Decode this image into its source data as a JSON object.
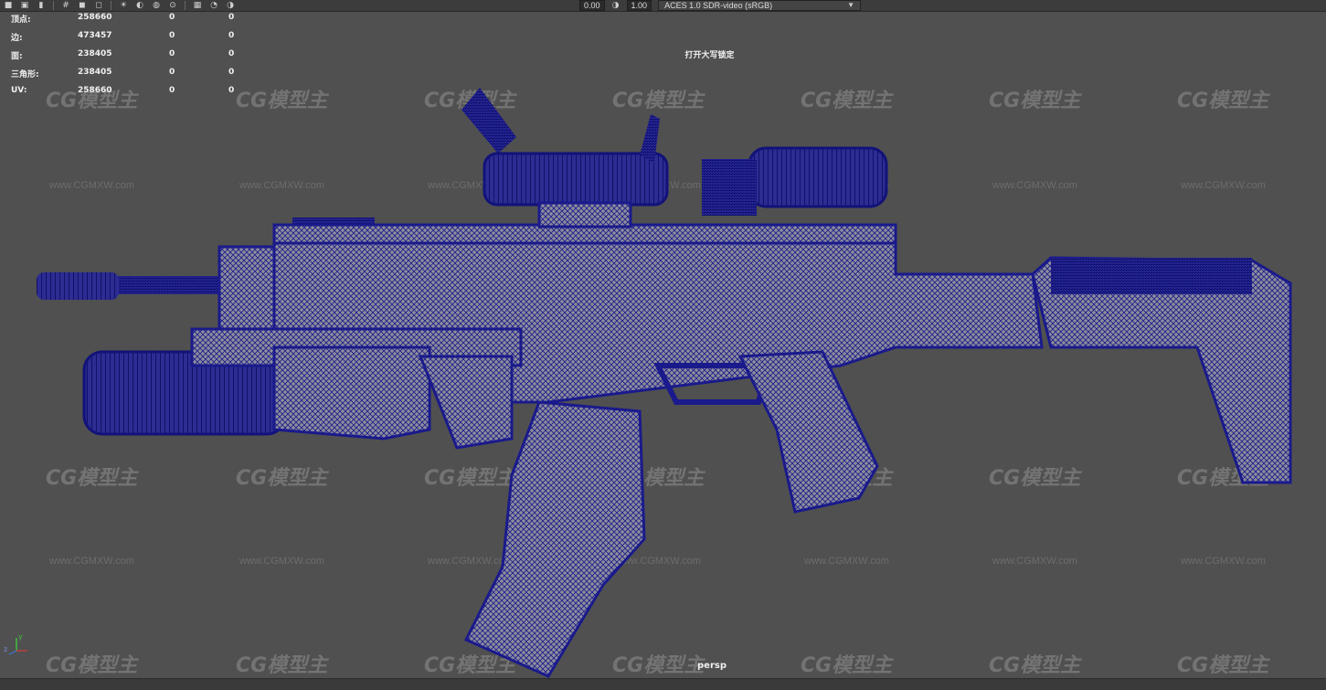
{
  "toolbar": {
    "exposure_value": "0.00",
    "gamma_value": "1.00",
    "color_space": "ACES 1.0 SDR-video (sRGB)",
    "icons": [
      "camera-icon",
      "film-icon",
      "bookmark-icon",
      "grid-icon",
      "shaded-icon",
      "wireframe-icon",
      "light-icon",
      "shadow-icon",
      "ao-icon",
      "isolate-icon",
      "xray-icon",
      "exposure-icon",
      "gamma-icon"
    ]
  },
  "hud": {
    "rows": [
      {
        "label": "顶点:",
        "v1": "258660",
        "v2": "0",
        "v3": "0"
      },
      {
        "label": "边:",
        "v1": "473457",
        "v2": "0",
        "v3": "0"
      },
      {
        "label": "面:",
        "v1": "238405",
        "v2": "0",
        "v3": "0"
      },
      {
        "label": "三角形:",
        "v1": "238405",
        "v2": "0",
        "v3": "0"
      },
      {
        "label": "UV:",
        "v1": "258660",
        "v2": "0",
        "v3": "0"
      }
    ]
  },
  "viewport": {
    "caps_lock_message": "打开大写锁定",
    "camera": "persp",
    "axis_labels": {
      "y": "y",
      "z": "z"
    }
  },
  "watermark": {
    "logo_text": "CG模型主",
    "url": "www.CGMXW.com"
  },
  "colors": {
    "viewport_bg": "#505050",
    "wire": "#1a1a8c",
    "surface": "#8a8a9a"
  }
}
